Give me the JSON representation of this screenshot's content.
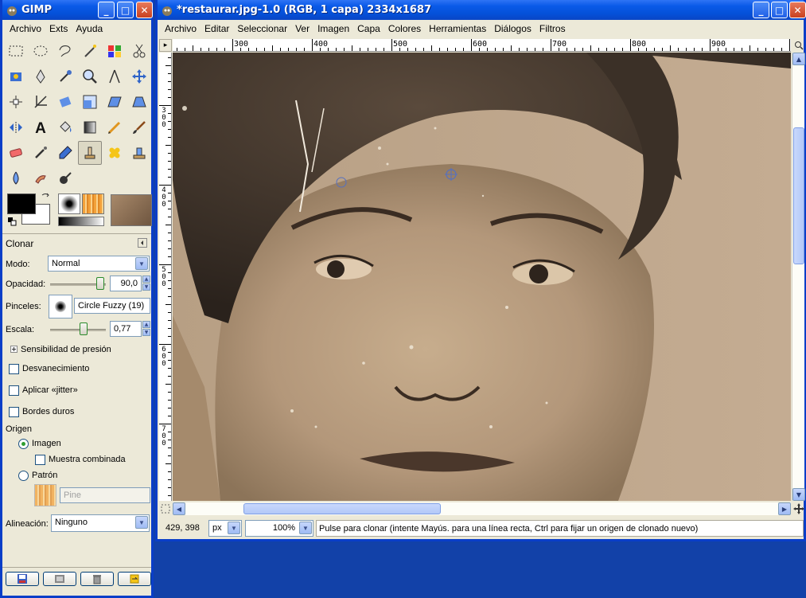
{
  "toolbox": {
    "title": "GIMP",
    "menu": [
      "Archivo",
      "Exts",
      "Ayuda"
    ],
    "tool_options": {
      "title": "Clonar",
      "mode_label": "Modo:",
      "mode_value": "Normal",
      "opacity_label": "Opacidad:",
      "opacity_value": "90,0",
      "opacity_level": 0.9,
      "brushes_label": "Pinceles:",
      "brush_value": "Circle Fuzzy (19)",
      "scale_label": "Escala:",
      "scale_value": "0,77",
      "pressure_label": "Sensibilidad de presión",
      "fade_label": "Desvanecimiento",
      "jitter_label": "Aplicar «jitter»",
      "hard_edges_label": "Bordes duros",
      "source_label": "Origen",
      "image_label": "Imagen",
      "sample_merged_label": "Muestra combinada",
      "pattern_label": "Patrón",
      "pattern_value": "Pine",
      "alignment_label": "Alineación:",
      "alignment_value": "Ninguno"
    }
  },
  "image_window": {
    "title": "*restaurar.jpg-1.0 (RGB, 1 capa) 2334x1687",
    "menu": [
      "Archivo",
      "Editar",
      "Seleccionar",
      "Ver",
      "Imagen",
      "Capa",
      "Colores",
      "Herramientas",
      "Diálogos",
      "Filtros"
    ],
    "hruler_labels": [
      "300",
      "400",
      "500",
      "600",
      "700",
      "800",
      "900"
    ],
    "vruler_labels": [
      "300",
      "400",
      "500",
      "600",
      "700"
    ],
    "status": {
      "coords": "429, 398",
      "unit": "px",
      "zoom": "100%",
      "message": "Pulse para clonar (intente Mayús. para una línea recta, Ctrl para fijar un origen de clonado nuevo)"
    }
  },
  "colors": {
    "fg": "#000000",
    "bg": "#ffffff",
    "title_blue": "#0450d8",
    "desktop": "#1241a8"
  }
}
